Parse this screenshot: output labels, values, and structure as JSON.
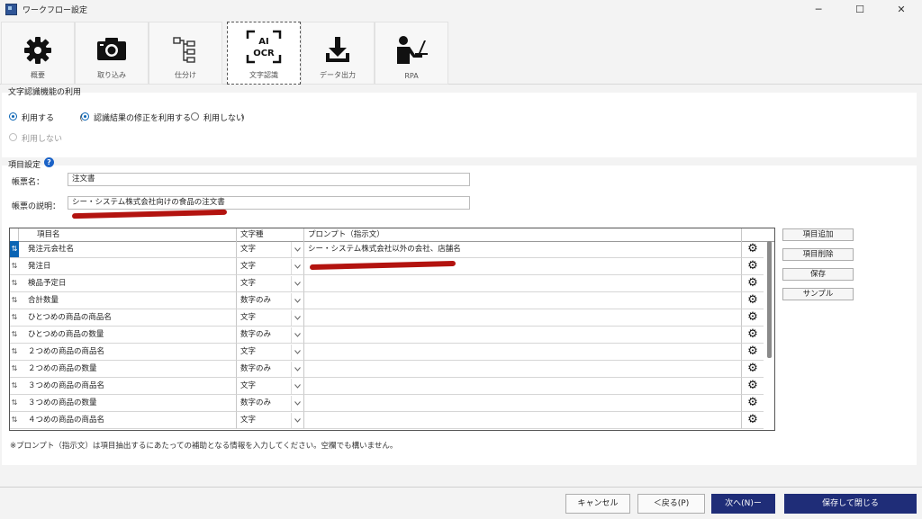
{
  "window": {
    "title": "ワークフロー設定",
    "minimize": "─",
    "maximize": "☐",
    "close": "✕"
  },
  "tabs": [
    {
      "label": "概要",
      "icon": "gear-icon"
    },
    {
      "label": "取り込み",
      "icon": "camera-icon"
    },
    {
      "label": "仕分け",
      "icon": "sort-tree-icon"
    },
    {
      "label": "文字認識",
      "icon": "ai-ocr-icon",
      "active": true
    },
    {
      "label": "データ出力",
      "icon": "download-icon"
    },
    {
      "label": "RPA",
      "icon": "rpa-icon"
    }
  ],
  "ocr_group": {
    "title": "文字認識機能の利用",
    "use": "利用する",
    "paren_open": "（",
    "use_correction": "認識結果の修正を利用する",
    "no_correction": "利用しない",
    "paren_close": "）",
    "not_use": "利用しない"
  },
  "item_group": {
    "title": "項目設定",
    "help": "?",
    "form_name_label": "帳票名：",
    "form_name_value": "注文書",
    "form_desc_label": "帳票の説明：",
    "form_desc_value": "シー・システム株式会社向けの食品の注文書"
  },
  "table": {
    "headers": [
      "項目名",
      "文字種",
      "プロンプト（指示文）"
    ],
    "sort_glyph": "⇅",
    "gear_glyph": "⚙",
    "rows": [
      {
        "name": "発注元会社名",
        "type": "文字",
        "prompt": "シー・システム株式会社以外の会社、店舗名"
      },
      {
        "name": "発注日",
        "type": "文字",
        "prompt": ""
      },
      {
        "name": "検品予定日",
        "type": "文字",
        "prompt": ""
      },
      {
        "name": "合計数量",
        "type": "数字のみ",
        "prompt": ""
      },
      {
        "name": "ひとつめの商品の商品名",
        "type": "文字",
        "prompt": ""
      },
      {
        "name": "ひとつめの商品の数量",
        "type": "数字のみ",
        "prompt": ""
      },
      {
        "name": "２つめの商品の商品名",
        "type": "文字",
        "prompt": ""
      },
      {
        "name": "２つめの商品の数量",
        "type": "数字のみ",
        "prompt": ""
      },
      {
        "name": "３つめの商品の商品名",
        "type": "文字",
        "prompt": ""
      },
      {
        "name": "３つめの商品の数量",
        "type": "数字のみ",
        "prompt": ""
      },
      {
        "name": "４つめの商品の商品名",
        "type": "文字",
        "prompt": ""
      }
    ]
  },
  "side_buttons": {
    "add": "項目追加",
    "delete": "項目削除",
    "save": "保存",
    "sample": "サンプル"
  },
  "note": "※プロンプト（指示文）は項目抽出するにあたっての補助となる情報を入力してください。空欄でも構いません。",
  "footer": {
    "cancel": "キャンセル",
    "back": "＜戻る(P)",
    "next": "次へ(N)ー",
    "save_close": "保存して閉じる"
  },
  "colors": {
    "accent": "#0a64b4",
    "primary_button": "#1f2d78",
    "annotation": "#b3130f"
  }
}
